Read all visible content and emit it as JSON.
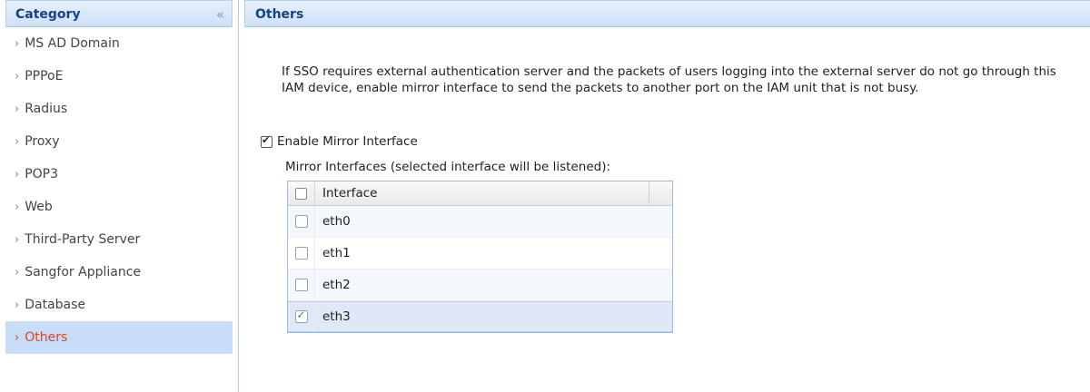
{
  "sidebar": {
    "title": "Category",
    "collapse_glyph": "«",
    "items": [
      {
        "label": "MS AD Domain",
        "active": false
      },
      {
        "label": "PPPoE",
        "active": false
      },
      {
        "label": "Radius",
        "active": false
      },
      {
        "label": "Proxy",
        "active": false
      },
      {
        "label": "POP3",
        "active": false
      },
      {
        "label": "Web",
        "active": false
      },
      {
        "label": "Third-Party Server",
        "active": false
      },
      {
        "label": "Sangfor Appliance",
        "active": false
      },
      {
        "label": "Database",
        "active": false
      },
      {
        "label": "Others",
        "active": true
      }
    ],
    "arrow_glyph": "›"
  },
  "main": {
    "title": "Others",
    "description": "If SSO requires external authentication server and the packets of users logging into the external server do not go through this IAM device, enable mirror interface to send the packets to another port on the IAM unit that is not busy.",
    "enable_mirror": {
      "label": "Enable Mirror Interface",
      "checked": true
    },
    "mirror_label": "Mirror Interfaces (selected interface will be listened):",
    "grid": {
      "header": "Interface",
      "rows": [
        {
          "name": "eth0",
          "checked": false
        },
        {
          "name": "eth1",
          "checked": false
        },
        {
          "name": "eth2",
          "checked": false
        },
        {
          "name": "eth3",
          "checked": true
        }
      ]
    }
  },
  "colors": {
    "header_text": "#15428b",
    "active_item_text": "#e0451c",
    "active_item_bg": "#c6dcf7",
    "check_green": "#1a9e2b"
  }
}
